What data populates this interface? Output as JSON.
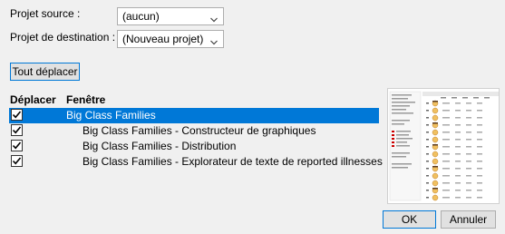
{
  "source_project": {
    "label": "Projet source :",
    "value": "(aucun)"
  },
  "dest_project": {
    "label": "Projet de destination :",
    "value": "(Nouveau projet)"
  },
  "move_all_button": "Tout déplacer",
  "table": {
    "headers": {
      "move": "Déplacer",
      "window": "Fenêtre"
    },
    "rows": [
      {
        "checked": true,
        "title": "Big Class Families",
        "selected": true
      },
      {
        "checked": true,
        "title": "Big Class Families - Constructeur de graphiques",
        "selected": false
      },
      {
        "checked": true,
        "title": "Big Class Families - Distribution",
        "selected": false
      },
      {
        "checked": true,
        "title": "Big Class Families - Explorateur de texte de reported illnesses",
        "selected": false
      }
    ]
  },
  "ok_button": "OK",
  "cancel_button": "Annuler",
  "icons": {
    "dropdown": "chevron-down-icon",
    "check": "checkmark-icon",
    "preview": "window-preview-thumbnail"
  },
  "colors": {
    "selection": "#0078d7",
    "focus_border": "#0078d7"
  }
}
